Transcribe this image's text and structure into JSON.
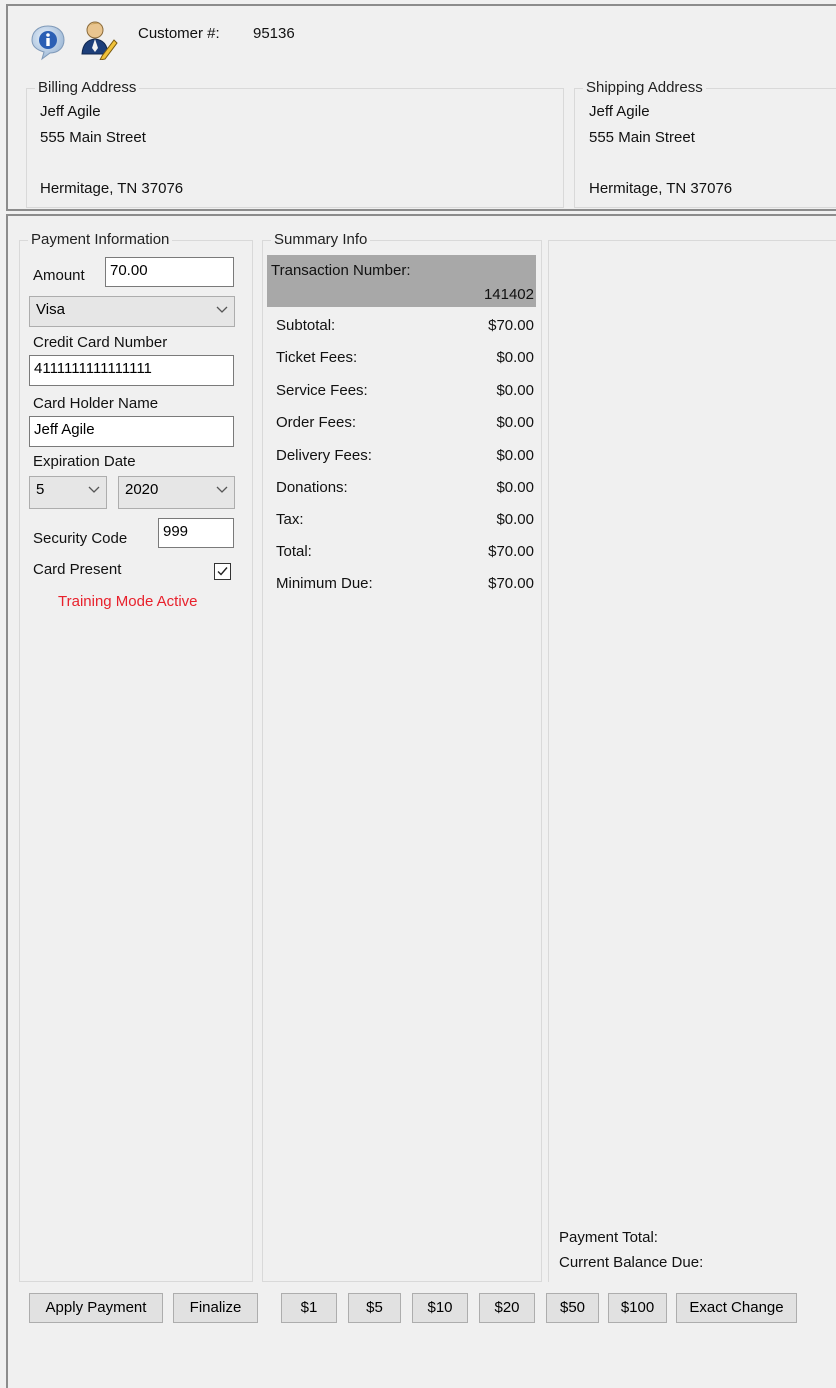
{
  "customer": {
    "label": "Customer #:",
    "number": "95136",
    "info_icon": "info-icon",
    "user_icon": "user-edit-icon"
  },
  "billing": {
    "caption": "Billing Address",
    "name": "Jeff Agile",
    "street": "555 Main Street",
    "city_state_zip": "Hermitage, TN 37076"
  },
  "shipping": {
    "caption": "Shipping Address",
    "name": "Jeff Agile",
    "street": "555 Main Street",
    "city_state_zip": "Hermitage, TN 37076"
  },
  "payment": {
    "caption": "Payment Information",
    "amount_label": "Amount",
    "amount_value": "70.00",
    "card_type": "Visa",
    "cc_label": "Credit Card Number",
    "cc_value": "4111111111111111",
    "holder_label": "Card Holder Name",
    "holder_value": "Jeff Agile",
    "exp_label": "Expiration Date",
    "exp_month": "5",
    "exp_year": "2020",
    "security_label": "Security Code",
    "security_value": "999",
    "card_present_label": "Card Present",
    "card_present_checked": true,
    "training_mode": "Training Mode Active",
    "training_color": "#e8212c"
  },
  "summary": {
    "caption": "Summary Info",
    "transaction_label": "Transaction Number:",
    "transaction_number": "141402",
    "rows": [
      {
        "label": "Subtotal:",
        "value": "$70.00"
      },
      {
        "label": "Ticket Fees:",
        "value": "$0.00"
      },
      {
        "label": "Service Fees:",
        "value": "$0.00"
      },
      {
        "label": "Order Fees:",
        "value": "$0.00"
      },
      {
        "label": "Delivery Fees:",
        "value": "$0.00"
      },
      {
        "label": "Donations:",
        "value": "$0.00"
      },
      {
        "label": "Tax:",
        "value": "$0.00"
      },
      {
        "label": "Total:",
        "value": "$70.00"
      },
      {
        "label": "Minimum Due:",
        "value": "$70.00"
      }
    ]
  },
  "totals": {
    "payment_total_label": "Payment Total:",
    "balance_due_label": "Current Balance Due:"
  },
  "buttons": {
    "apply": "Apply Payment",
    "finalize": "Finalize",
    "d1": "$1",
    "d5": "$5",
    "d10": "$10",
    "d20": "$20",
    "d50": "$50",
    "d100": "$100",
    "exact": "Exact Change"
  }
}
